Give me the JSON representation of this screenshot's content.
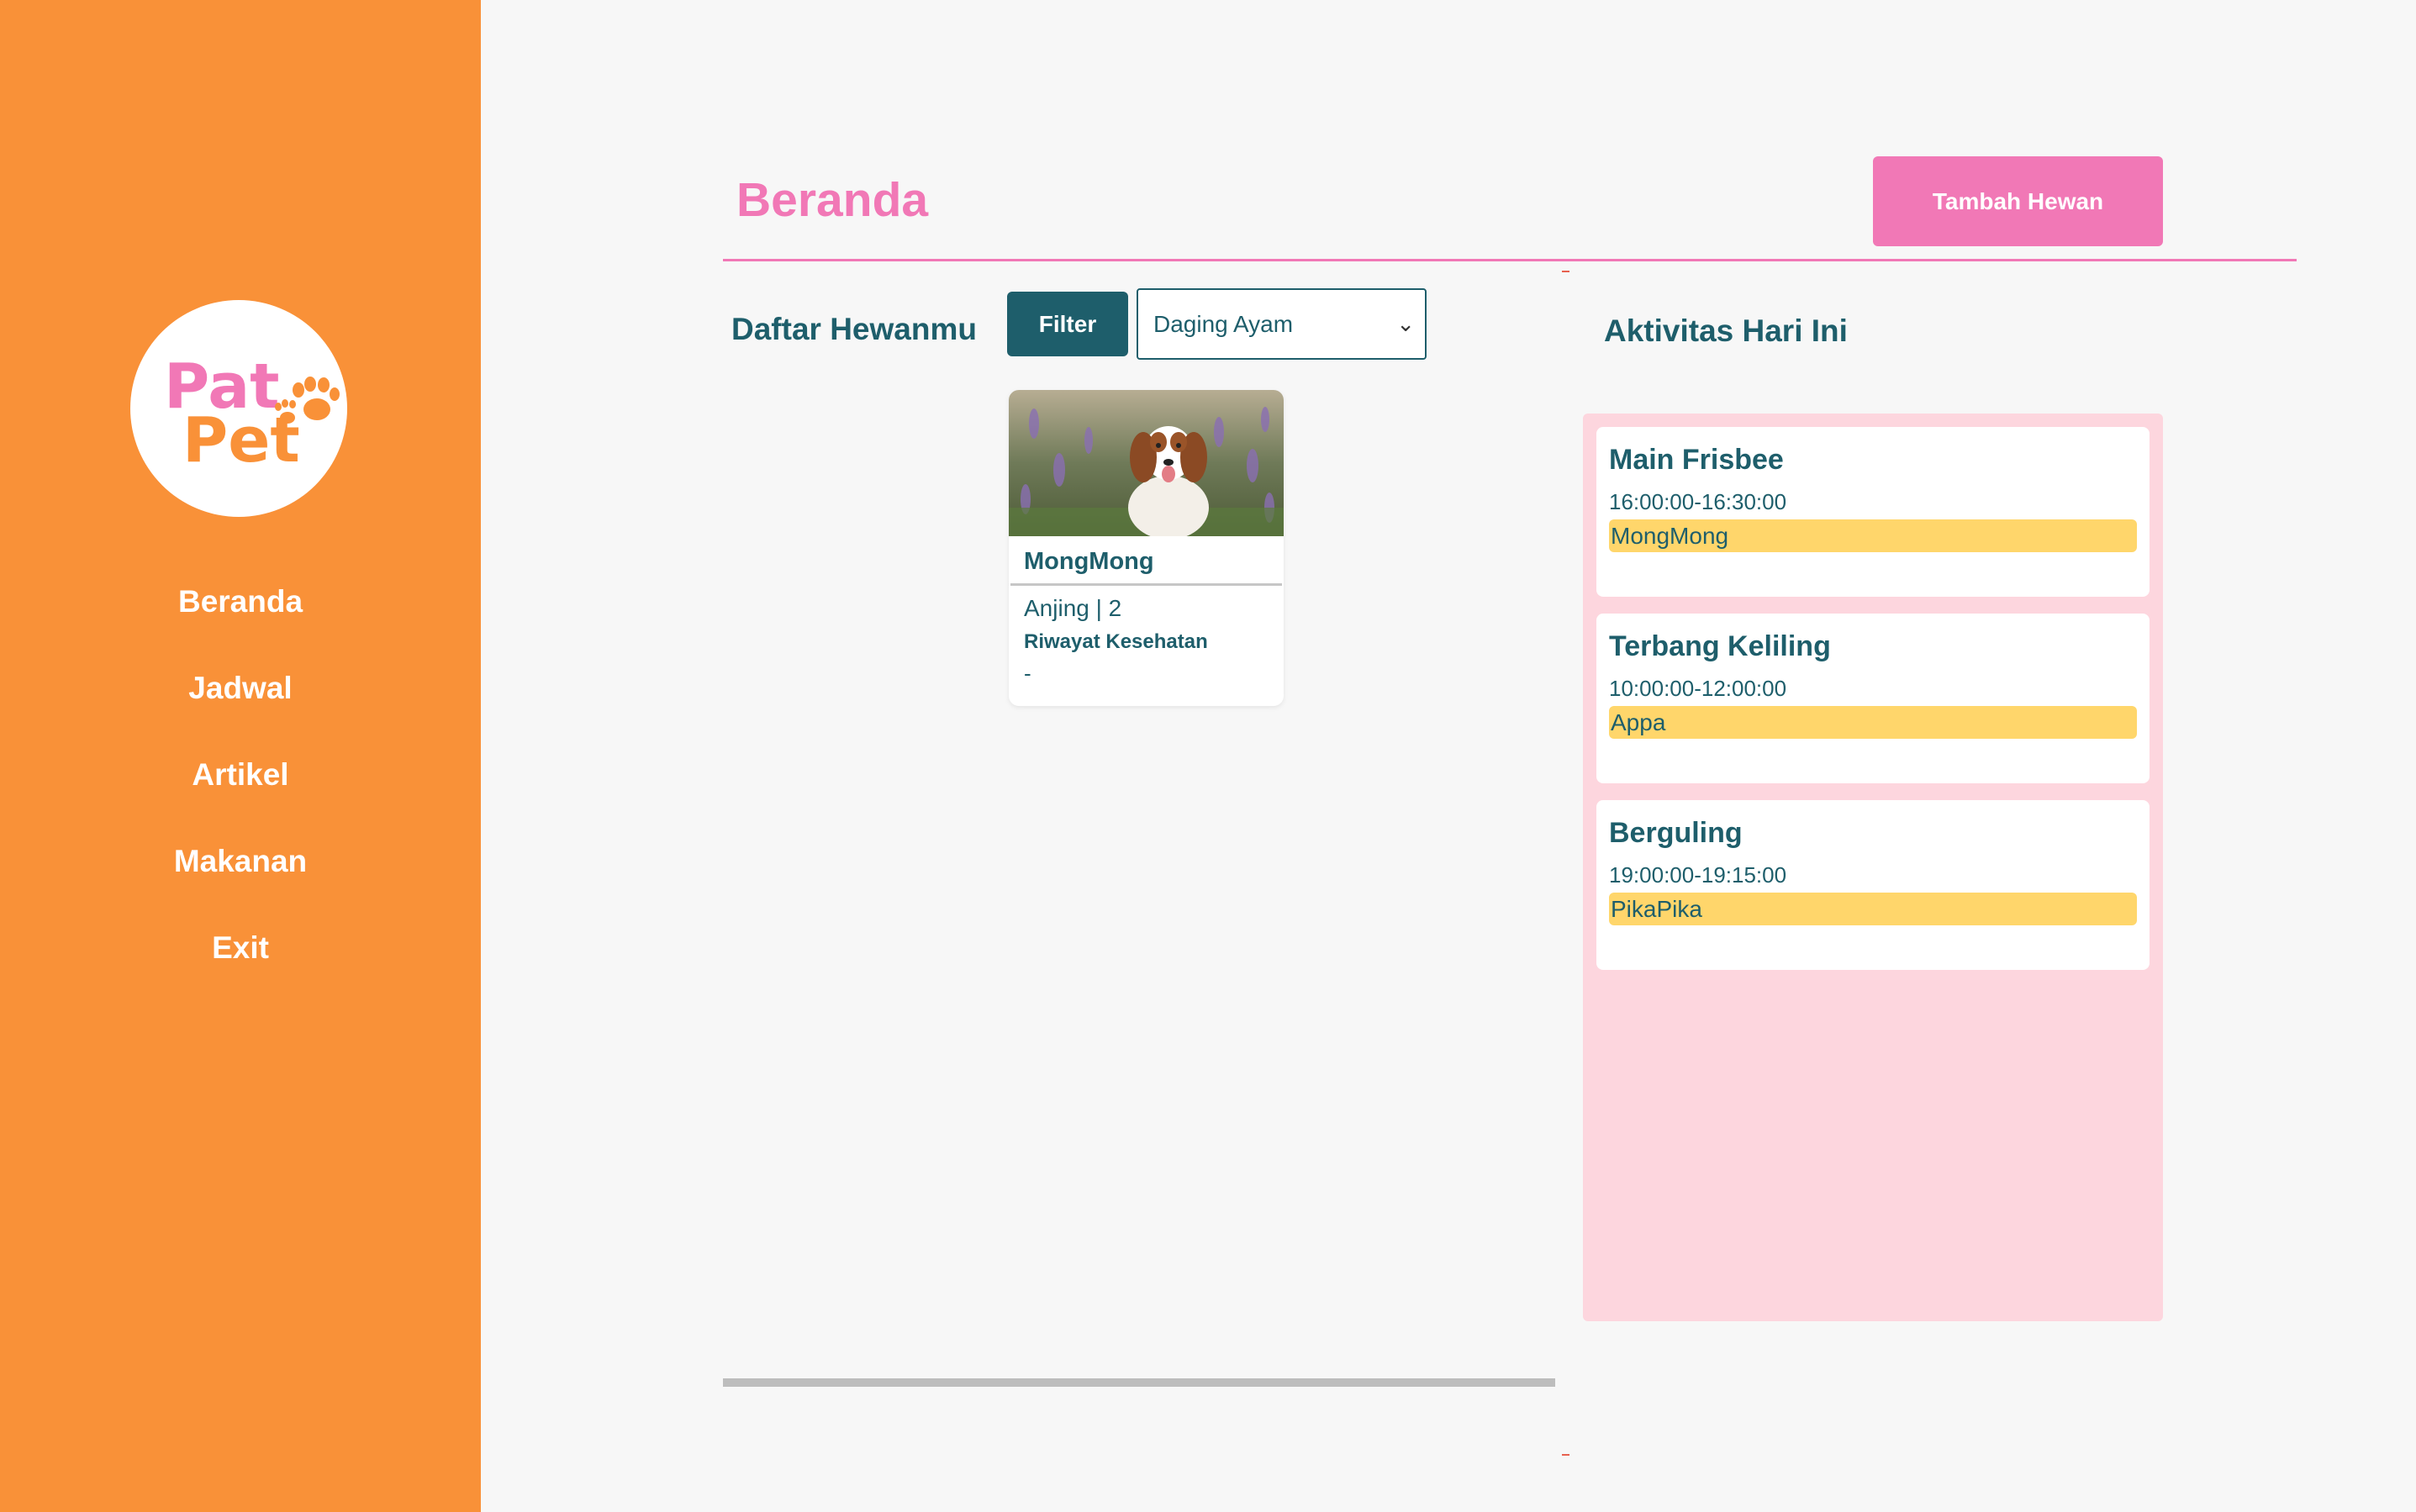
{
  "app": {
    "logo_text_line1": "Pat",
    "logo_text_line2": "Pet"
  },
  "sidebar": {
    "items": [
      {
        "label": "Beranda"
      },
      {
        "label": "Jadwal"
      },
      {
        "label": "Artikel"
      },
      {
        "label": "Makanan"
      },
      {
        "label": "Exit"
      }
    ]
  },
  "header": {
    "title": "Beranda",
    "add_button": "Tambah Hewan"
  },
  "pets": {
    "title": "Daftar Hewanmu",
    "filter_label": "Filter",
    "filter_selected": "Daging Ayam",
    "cards": [
      {
        "name": "MongMong",
        "type_age": "Anjing | 2",
        "health_label": "Riwayat Kesehatan",
        "health_value": "-"
      }
    ]
  },
  "activities": {
    "title": "Aktivitas Hari Ini",
    "items": [
      {
        "name": "Main Frisbee",
        "time": "16:00:00-16:30:00",
        "pet": "MongMong"
      },
      {
        "name": "Terbang Keliling",
        "time": "10:00:00-12:00:00",
        "pet": "Appa"
      },
      {
        "name": "Berguling",
        "time": "19:00:00-19:15:00",
        "pet": "PikaPika"
      }
    ]
  },
  "colors": {
    "sidebar": "#f99138",
    "accent_pink": "#f178b6",
    "teal": "#1e5e6b",
    "activity_bg": "#fdd6de",
    "pet_tag": "#ffd66b"
  }
}
